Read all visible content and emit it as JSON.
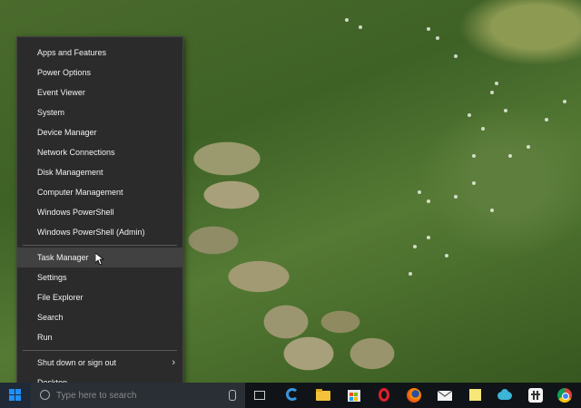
{
  "menu": {
    "items_group1": [
      {
        "label": "Apps and Features"
      },
      {
        "label": "Power Options"
      },
      {
        "label": "Event Viewer"
      },
      {
        "label": "System"
      },
      {
        "label": "Device Manager"
      },
      {
        "label": "Network Connections"
      },
      {
        "label": "Disk Management"
      },
      {
        "label": "Computer Management"
      },
      {
        "label": "Windows PowerShell"
      },
      {
        "label": "Windows PowerShell (Admin)"
      }
    ],
    "items_group2": [
      {
        "label": "Task Manager"
      },
      {
        "label": "Settings"
      },
      {
        "label": "File Explorer"
      },
      {
        "label": "Search"
      },
      {
        "label": "Run"
      }
    ],
    "items_group3": [
      {
        "label": "Shut down or sign out"
      },
      {
        "label": "Desktop"
      }
    ],
    "hovered_item": "Task Manager"
  },
  "taskbar": {
    "search_placeholder": "Type here to search",
    "icons": [
      "windows-logo-icon",
      "microphone-icon",
      "task-view-icon",
      "edge-icon",
      "file-explorer-icon",
      "store-icon",
      "opera-icon",
      "firefox-icon",
      "mail-icon",
      "sticky-notes-icon",
      "cloud-icon",
      "slack-icon",
      "chrome-icon"
    ],
    "accent": "#0078d7"
  }
}
